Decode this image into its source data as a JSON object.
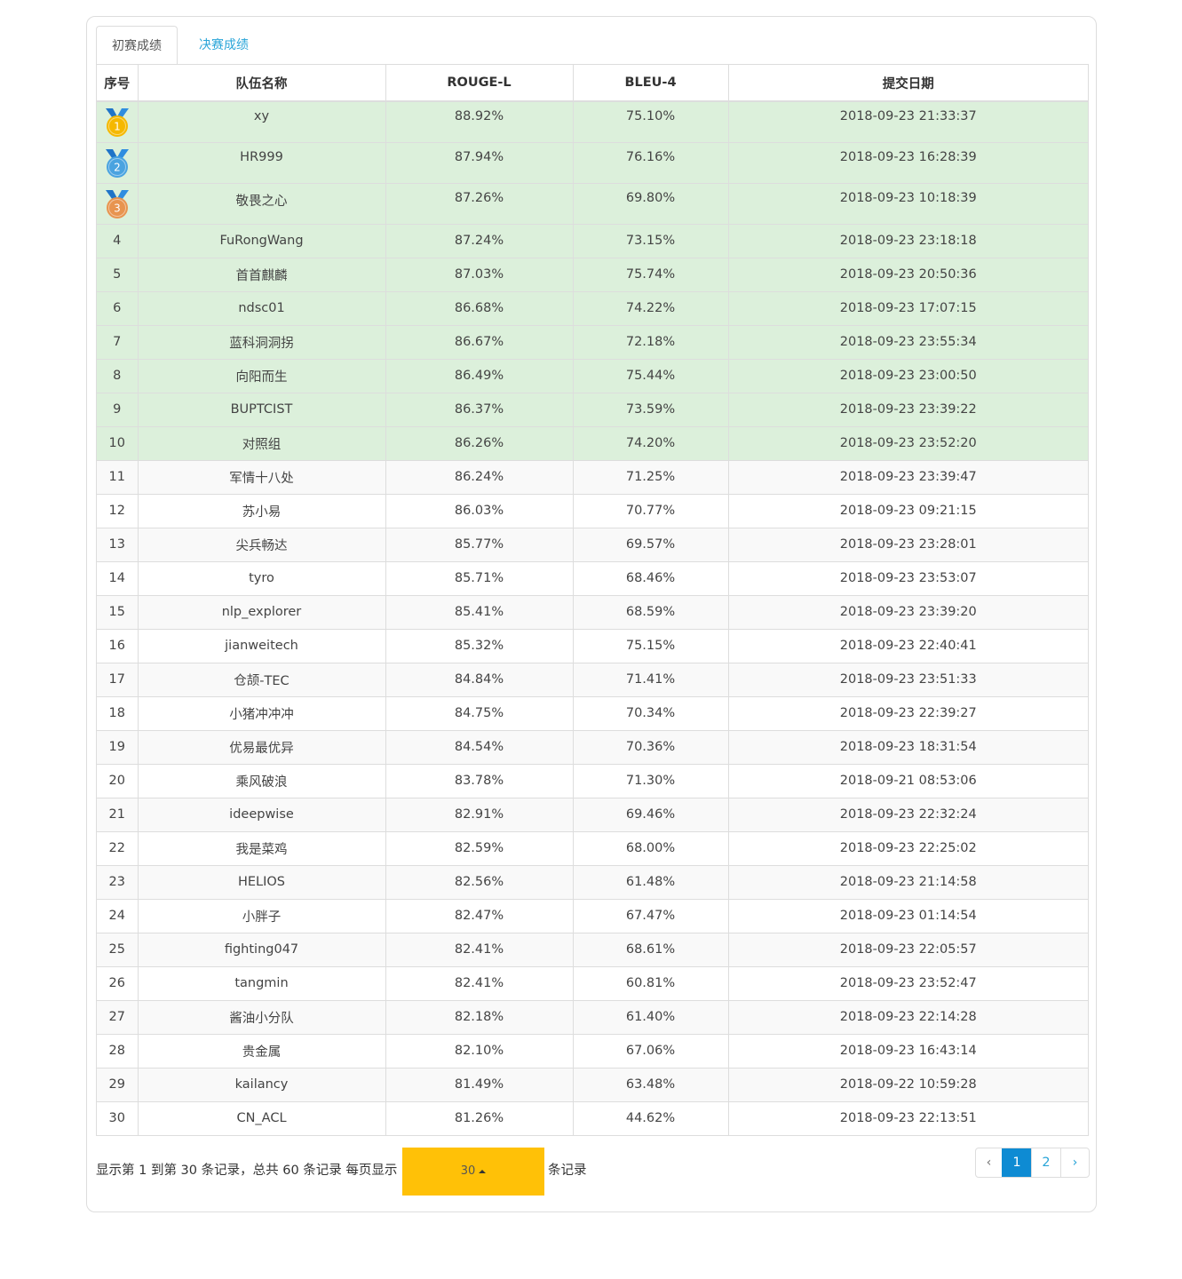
{
  "tabs": [
    {
      "label": "初赛成绩",
      "active": true
    },
    {
      "label": "决赛成绩",
      "active": false
    }
  ],
  "table": {
    "headers": [
      "序号",
      "队伍名称",
      "ROUGE-L",
      "BLEU-4",
      "提交日期"
    ],
    "rows": [
      {
        "rank": "1",
        "team": "xy",
        "rouge": "88.92%",
        "bleu": "75.10%",
        "date": "2018-09-23 21:33:37",
        "medal": "gold"
      },
      {
        "rank": "2",
        "team": "HR999",
        "rouge": "87.94%",
        "bleu": "76.16%",
        "date": "2018-09-23 16:28:39",
        "medal": "silver"
      },
      {
        "rank": "3",
        "team": "敬畏之心",
        "rouge": "87.26%",
        "bleu": "69.80%",
        "date": "2018-09-23 10:18:39",
        "medal": "bronze"
      },
      {
        "rank": "4",
        "team": "FuRongWang",
        "rouge": "87.24%",
        "bleu": "73.15%",
        "date": "2018-09-23 23:18:18"
      },
      {
        "rank": "5",
        "team": "首首麒麟",
        "rouge": "87.03%",
        "bleu": "75.74%",
        "date": "2018-09-23 20:50:36"
      },
      {
        "rank": "6",
        "team": "ndsc01",
        "rouge": "86.68%",
        "bleu": "74.22%",
        "date": "2018-09-23 17:07:15"
      },
      {
        "rank": "7",
        "team": "蓝科洞洞拐",
        "rouge": "86.67%",
        "bleu": "72.18%",
        "date": "2018-09-23 23:55:34"
      },
      {
        "rank": "8",
        "team": "向阳而生",
        "rouge": "86.49%",
        "bleu": "75.44%",
        "date": "2018-09-23 23:00:50"
      },
      {
        "rank": "9",
        "team": "BUPTCIST",
        "rouge": "86.37%",
        "bleu": "73.59%",
        "date": "2018-09-23 23:39:22"
      },
      {
        "rank": "10",
        "team": "对照组",
        "rouge": "86.26%",
        "bleu": "74.20%",
        "date": "2018-09-23 23:52:20"
      },
      {
        "rank": "11",
        "team": "军情十八处",
        "rouge": "86.24%",
        "bleu": "71.25%",
        "date": "2018-09-23 23:39:47"
      },
      {
        "rank": "12",
        "team": "苏小易",
        "rouge": "86.03%",
        "bleu": "70.77%",
        "date": "2018-09-23 09:21:15"
      },
      {
        "rank": "13",
        "team": "尖兵畅达",
        "rouge": "85.77%",
        "bleu": "69.57%",
        "date": "2018-09-23 23:28:01"
      },
      {
        "rank": "14",
        "team": "tyro",
        "rouge": "85.71%",
        "bleu": "68.46%",
        "date": "2018-09-23 23:53:07"
      },
      {
        "rank": "15",
        "team": "nlp_explorer",
        "rouge": "85.41%",
        "bleu": "68.59%",
        "date": "2018-09-23 23:39:20"
      },
      {
        "rank": "16",
        "team": "jianweitech",
        "rouge": "85.32%",
        "bleu": "75.15%",
        "date": "2018-09-23 22:40:41"
      },
      {
        "rank": "17",
        "team": "仓颉-TEC",
        "rouge": "84.84%",
        "bleu": "71.41%",
        "date": "2018-09-23 23:51:33"
      },
      {
        "rank": "18",
        "team": "小猪冲冲冲",
        "rouge": "84.75%",
        "bleu": "70.34%",
        "date": "2018-09-23 22:39:27"
      },
      {
        "rank": "19",
        "team": "优易最优异",
        "rouge": "84.54%",
        "bleu": "70.36%",
        "date": "2018-09-23 18:31:54"
      },
      {
        "rank": "20",
        "team": "乘风破浪",
        "rouge": "83.78%",
        "bleu": "71.30%",
        "date": "2018-09-21 08:53:06"
      },
      {
        "rank": "21",
        "team": "ideepwise",
        "rouge": "82.91%",
        "bleu": "69.46%",
        "date": "2018-09-23 22:32:24"
      },
      {
        "rank": "22",
        "team": "我是菜鸡",
        "rouge": "82.59%",
        "bleu": "68.00%",
        "date": "2018-09-23 22:25:02"
      },
      {
        "rank": "23",
        "team": "HELIOS",
        "rouge": "82.56%",
        "bleu": "61.48%",
        "date": "2018-09-23 21:14:58"
      },
      {
        "rank": "24",
        "team": "小胖子",
        "rouge": "82.47%",
        "bleu": "67.47%",
        "date": "2018-09-23 01:14:54"
      },
      {
        "rank": "25",
        "team": "fighting047",
        "rouge": "82.41%",
        "bleu": "68.61%",
        "date": "2018-09-23 22:05:57"
      },
      {
        "rank": "26",
        "team": "tangmin",
        "rouge": "82.41%",
        "bleu": "60.81%",
        "date": "2018-09-23 23:52:47"
      },
      {
        "rank": "27",
        "team": "酱油小分队",
        "rouge": "82.18%",
        "bleu": "61.40%",
        "date": "2018-09-23 22:14:28"
      },
      {
        "rank": "28",
        "team": "贵金属",
        "rouge": "82.10%",
        "bleu": "67.06%",
        "date": "2018-09-23 16:43:14"
      },
      {
        "rank": "29",
        "team": "kailancy",
        "rouge": "81.49%",
        "bleu": "63.48%",
        "date": "2018-09-22 10:59:28"
      },
      {
        "rank": "30",
        "team": "CN_ACL",
        "rouge": "81.26%",
        "bleu": "44.62%",
        "date": "2018-09-23 22:13:51"
      }
    ]
  },
  "footer": {
    "summary": "显示第 1 到第 30 条记录，总共 60 条记录 每页显示",
    "page_size": "30",
    "suffix": "条记录"
  },
  "pagination": {
    "prev": "‹",
    "pages": [
      "1",
      "2"
    ],
    "current": "1",
    "next": "›"
  },
  "colors": {
    "highlight_row": "#dcf0db",
    "tab_link": "#2aa5d8",
    "page_active": "#0e8bd3",
    "page_size_button": "#ffc107",
    "medal_gold": "#f5b800",
    "medal_silver": "#4aa3e0",
    "medal_bronze": "#e8944f"
  }
}
